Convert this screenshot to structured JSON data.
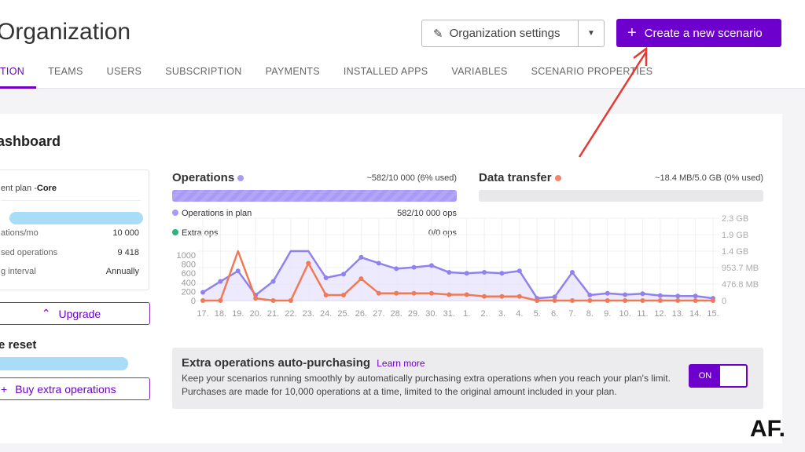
{
  "header": {
    "title": "Organization",
    "org_settings_label": "Organization settings",
    "create_label": "Create a new scenario"
  },
  "tabs": [
    "TION",
    "TEAMS",
    "USERS",
    "SUBSCRIPTION",
    "PAYMENTS",
    "INSTALLED APPS",
    "VARIABLES",
    "SCENARIO PROPERTIES"
  ],
  "dashboard": {
    "title": "ashboard"
  },
  "plan": {
    "heading_prefix": "ent plan - ",
    "heading_plan": "Core",
    "rows": [
      {
        "label": "ations/mo",
        "value": "10 000"
      },
      {
        "label": "sed operations",
        "value": "9 418"
      },
      {
        "label": "g interval",
        "value": "Annually"
      }
    ],
    "upgrade_label": "Upgrade"
  },
  "reset": {
    "title": "e reset",
    "buy_label": "Buy extra operations"
  },
  "operations": {
    "title": "Operations",
    "summary": "~582/10 000 (6% used)",
    "used_fraction": 0.058,
    "color": "#a99af5",
    "legend": [
      {
        "label": "Operations in plan",
        "value": "582/10 000 ops",
        "color": "#a99af5"
      },
      {
        "label": "Extra ops",
        "value": "0/0 ops",
        "color": "#2fb37a"
      }
    ]
  },
  "data_transfer": {
    "title": "Data transfer",
    "summary": "~18.4 MB/5.0 GB (0% used)",
    "used_fraction": 0.0,
    "color": "#f4846a"
  },
  "chart_data": {
    "type": "line",
    "categories": [
      "17.",
      "18.",
      "19.",
      "20.",
      "21.",
      "22.",
      "23.",
      "24.",
      "25.",
      "26.",
      "27.",
      "28.",
      "29.",
      "30.",
      "31.",
      "1.",
      "2.",
      "3.",
      "4.",
      "5.",
      "6.",
      "7.",
      "8.",
      "9.",
      "10.",
      "11.",
      "12.",
      "13.",
      "14.",
      "15."
    ],
    "left_ticks": [
      "1000",
      "800",
      "600",
      "400",
      "200",
      "0"
    ],
    "right_ticks": [
      "2.3 GB",
      "1.9 GB",
      "1.4 GB",
      "953.7 MB",
      "476.8 MB",
      "0"
    ],
    "ylim": [
      0,
      1000
    ],
    "grid": true,
    "series": [
      {
        "name": "Operations",
        "color": "#8f82ee",
        "values": [
          180,
          420,
          650,
          120,
          420,
          1100,
          1100,
          500,
          580,
          950,
          820,
          700,
          730,
          770,
          620,
          600,
          620,
          600,
          650,
          50,
          80,
          620,
          120,
          160,
          130,
          150,
          110,
          100,
          100,
          50
        ]
      },
      {
        "name": "Data transfer",
        "color": "#f07a55",
        "values": [
          0,
          0,
          3000,
          50,
          0,
          0,
          820,
          120,
          120,
          480,
          160,
          160,
          160,
          160,
          130,
          130,
          90,
          90,
          90,
          0,
          0,
          0,
          0,
          0,
          0,
          0,
          0,
          0,
          0,
          0
        ]
      }
    ]
  },
  "extra": {
    "title": "Extra operations auto-purchasing",
    "learn_more": "Learn more",
    "description": "Keep your scenarios running smoothly by automatically purchasing extra operations when you reach your plan's limit. Purchases are made for 10,000 operations at a time, limited to the original amount included in your plan.",
    "toggle": "ON"
  },
  "watermark": "AF.",
  "annotation_color": "#e53935"
}
